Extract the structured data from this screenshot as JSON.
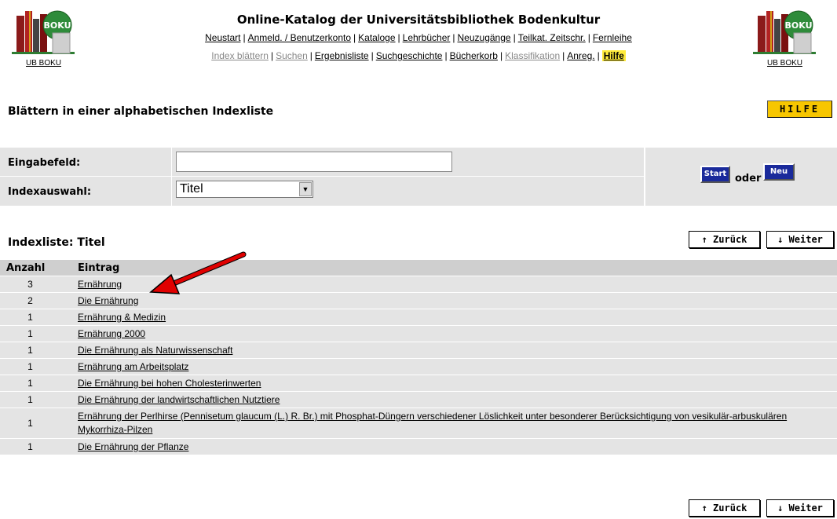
{
  "header": {
    "title": "Online-Katalog der Universitätsbibliothek Bodenkultur",
    "logo_caption_left": "UB BOKU",
    "logo_caption_right": "UB BOKU",
    "nav_row1": [
      "Neustart",
      "Anmeld. / Benutzerkonto",
      "Kataloge",
      "Lehrbücher",
      "Neuzugänge",
      "Teilkat. Zeitschr.",
      "Fernleihe"
    ],
    "nav_row2": [
      "Index blättern",
      "Suchen",
      "Ergebnisliste",
      "Suchgeschichte",
      "Bücherkorb",
      "Klassifikation",
      "Anreg.",
      "Hilfe"
    ]
  },
  "page": {
    "title": "Blättern in einer alphabetischen Indexliste",
    "help_button": "HILFE"
  },
  "search": {
    "input_label": "Eingabefeld:",
    "input_value": "",
    "index_label": "Indexauswahl:",
    "index_selected": "Titel",
    "start_button": "Start",
    "oder": "oder",
    "neu_button": "Neu"
  },
  "index_list": {
    "title": "Indexliste: Titel",
    "back_button": "↑ Zurück",
    "next_button": "↓ Weiter",
    "columns": [
      "Anzahl",
      "Eintrag"
    ],
    "rows": [
      {
        "count": "3",
        "entry": "Ernährung"
      },
      {
        "count": "2",
        "entry": "Die Ernährung"
      },
      {
        "count": "1",
        "entry": "Ernährung & Medizin"
      },
      {
        "count": "1",
        "entry": "Ernährung 2000"
      },
      {
        "count": "1",
        "entry": "Die Ernährung als Naturwissenschaft"
      },
      {
        "count": "1",
        "entry": "Ernährung am Arbeitsplatz"
      },
      {
        "count": "1",
        "entry": "Die Ernährung bei hohen Cholesterinwerten"
      },
      {
        "count": "1",
        "entry": "Die Ernährung der landwirtschaftlichen Nutztiere"
      },
      {
        "count": "1",
        "entry": "Ernährung der Perlhirse (Pennisetum glaucum (L.) R. Br.) mit Phosphat-Düngern verschiedener Löslichkeit unter besonderer Berücksichtigung von vesikulär-arbuskulären Mykorrhiza-Pilzen"
      },
      {
        "count": "1",
        "entry": "Die Ernährung der Pflanze"
      }
    ]
  },
  "colors": {
    "help_yellow": "#f7c600",
    "button_blue": "#1a2a9b",
    "row_gray": "#e4e4e4",
    "header_gray": "#cfcfcf",
    "annotation_red": "#e00000"
  }
}
